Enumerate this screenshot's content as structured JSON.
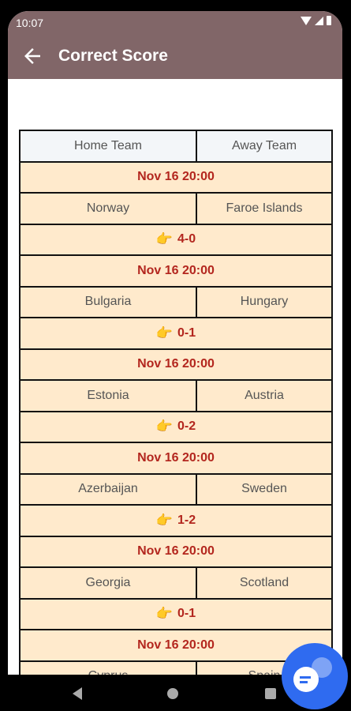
{
  "status_bar": {
    "time": "10:07"
  },
  "app_bar": {
    "title": "Correct Score"
  },
  "table": {
    "home_header": "Home Team",
    "away_header": "Away Team",
    "tip_icon": "👉",
    "matches": [
      {
        "date": "Nov 16 20:00",
        "home": "Norway",
        "away": "Faroe Islands",
        "score": "4-0"
      },
      {
        "date": "Nov 16 20:00",
        "home": "Bulgaria",
        "away": "Hungary",
        "score": "0-1"
      },
      {
        "date": "Nov 16 20:00",
        "home": "Estonia",
        "away": "Austria",
        "score": "0-2"
      },
      {
        "date": "Nov 16 20:00",
        "home": "Azerbaijan",
        "away": "Sweden",
        "score": "1-2"
      },
      {
        "date": "Nov 16 20:00",
        "home": "Georgia",
        "away": "Scotland",
        "score": "0-1"
      },
      {
        "date": "Nov 16 20:00",
        "home": "Cyprus",
        "away": "Spain",
        "score": ""
      }
    ]
  },
  "icons": {
    "back": "arrow-left-icon",
    "fab": "chat-icon",
    "nav_back": "triangle-back-icon",
    "nav_home": "circle-home-icon",
    "nav_recent": "square-recent-icon"
  },
  "colors": {
    "app_bar": "#816668",
    "row_background": "#ffeacc",
    "header_background": "#f3f6f9",
    "date_text": "#b3261e",
    "fab": "#2f6bf0"
  }
}
